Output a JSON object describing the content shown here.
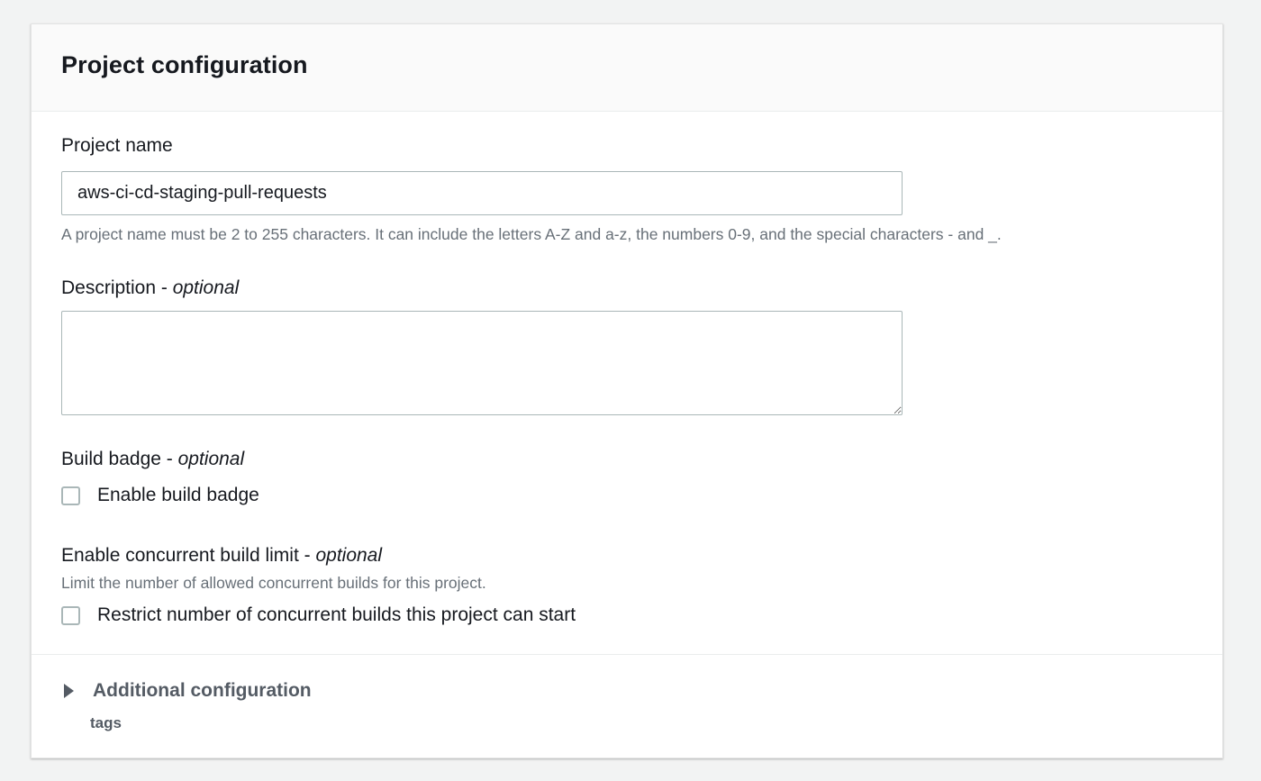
{
  "panel": {
    "title": "Project configuration"
  },
  "project_name": {
    "label": "Project name",
    "value": "aws-ci-cd-staging-pull-requests",
    "hint": "A project name must be 2 to 255 characters. It can include the letters A-Z and a-z, the numbers 0-9, and the special characters - and _."
  },
  "description": {
    "label": "Description - ",
    "optional": "optional",
    "value": ""
  },
  "build_badge": {
    "label": "Build badge - ",
    "optional": "optional",
    "checkbox_label": "Enable build badge",
    "checked": false
  },
  "concurrent_limit": {
    "label": "Enable concurrent build limit - ",
    "optional": "optional",
    "hint": "Limit the number of allowed concurrent builds for this project.",
    "checkbox_label": "Restrict number of concurrent builds this project can start",
    "checked": false
  },
  "additional": {
    "title": "Additional configuration",
    "subtitle": "tags"
  }
}
